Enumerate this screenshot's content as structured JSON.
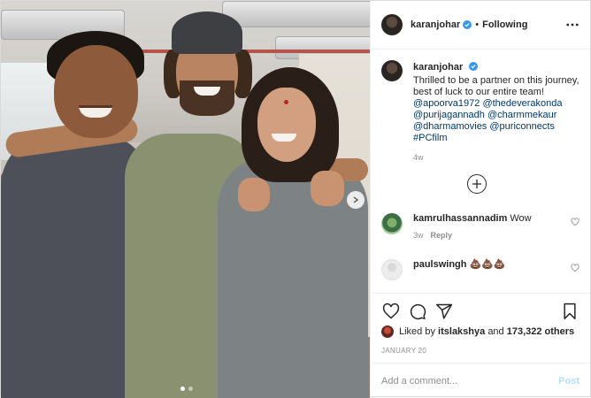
{
  "post": {
    "author": "karanjohar",
    "following_label": "Following",
    "separator": "•",
    "caption_text": "Thrilled to be a partner on this journey, best of luck to our entire team!",
    "mentions": [
      "@apoorva1972",
      "@thedeverakonda",
      "@purijagannadh",
      "@charmmekaur",
      "@dharmamovies",
      "@puriconnects",
      "#PCfilm"
    ],
    "time_ago": "4w",
    "carousel": {
      "slides": 2,
      "active_index": 0
    }
  },
  "comments": [
    {
      "user": "kamrulhassannadim",
      "text": "Wow",
      "time": "3w",
      "reply_label": "Reply"
    },
    {
      "user": "paulswingh",
      "text": "💩💩💩",
      "time": "",
      "reply_label": ""
    }
  ],
  "likes": {
    "prefix": "Liked by",
    "user": "itslakshya",
    "conjunction": "and",
    "others": "173,322 others"
  },
  "date": "JANUARY 20",
  "add_comment": {
    "placeholder": "Add a comment...",
    "post_label": "Post"
  },
  "colors": {
    "link": "#00376b",
    "verified": "#3897f0",
    "post_disabled": "#b2dffc",
    "muted": "#8e8e8e"
  },
  "icons": [
    "more-options-icon",
    "verified-badge-icon",
    "load-more-comments-icon",
    "heart-icon",
    "comment-icon",
    "share-icon",
    "bookmark-icon",
    "carousel-next-icon"
  ]
}
